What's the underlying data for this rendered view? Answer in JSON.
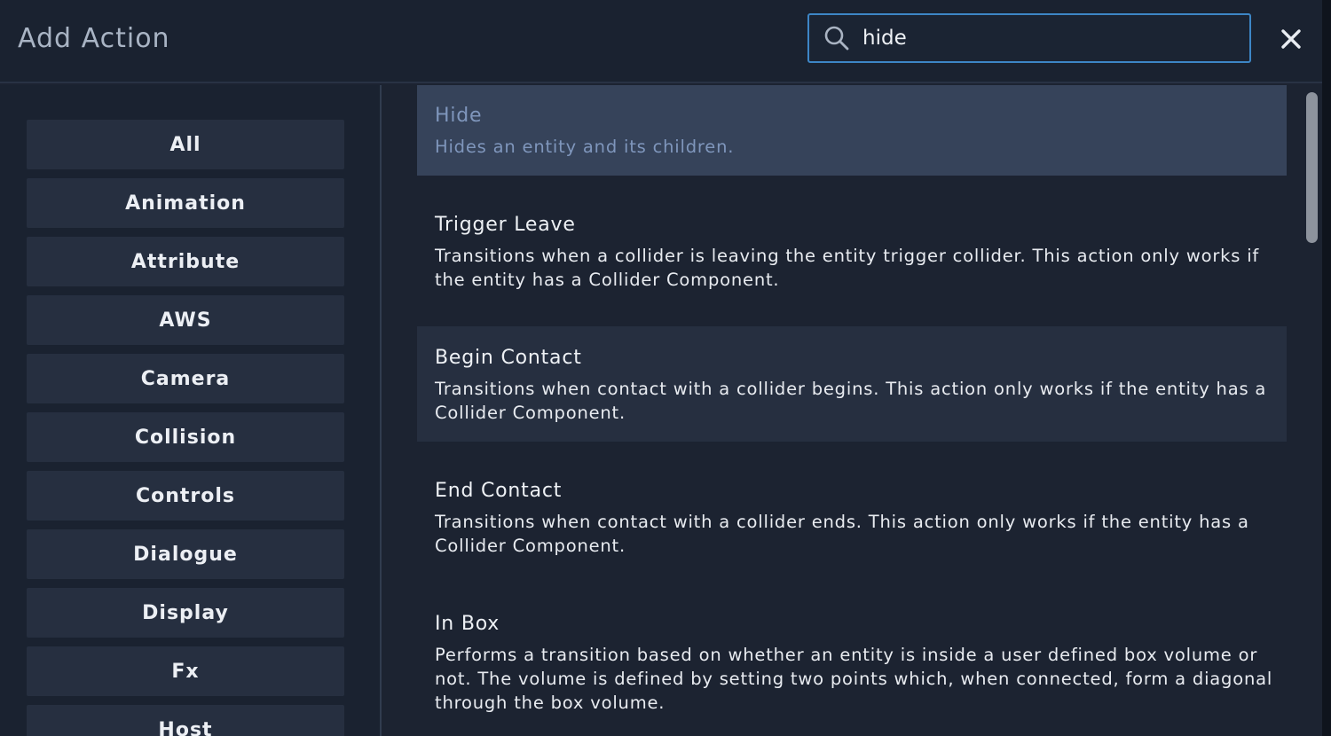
{
  "header": {
    "title": "Add Action",
    "search": {
      "value": "hide",
      "placeholder": ""
    }
  },
  "sidebar": {
    "categories": [
      "All",
      "Animation",
      "Attribute",
      "AWS",
      "Camera",
      "Collision",
      "Controls",
      "Dialogue",
      "Display",
      "Fx",
      "Host"
    ]
  },
  "actions": [
    {
      "title": "Hide",
      "desc": "Hides an entity and its children.",
      "state": "selected"
    },
    {
      "title": "Trigger Leave",
      "desc": "Transitions when a collider is leaving the entity trigger collider. This action only works if the entity has a Collider Component.",
      "state": "normal"
    },
    {
      "title": "Begin Contact",
      "desc": "Transitions when contact with a collider begins. This action only works if the entity has a Collider Component.",
      "state": "hover"
    },
    {
      "title": "End Contact",
      "desc": "Transitions when contact with a collider ends. This action only works if the entity has a Collider Component.",
      "state": "normal"
    },
    {
      "title": "In Box",
      "desc": "Performs a transition based on whether an entity is inside a user defined box volume or not. The volume is defined by setting two points which, when connected, form a diagonal through the box volume.",
      "state": "normal"
    }
  ],
  "icons": {
    "search": "search-icon",
    "close": "close-icon"
  },
  "colors": {
    "accent": "#3d86c6",
    "selected_bg": "#36435a",
    "hover_bg": "#262f40"
  }
}
